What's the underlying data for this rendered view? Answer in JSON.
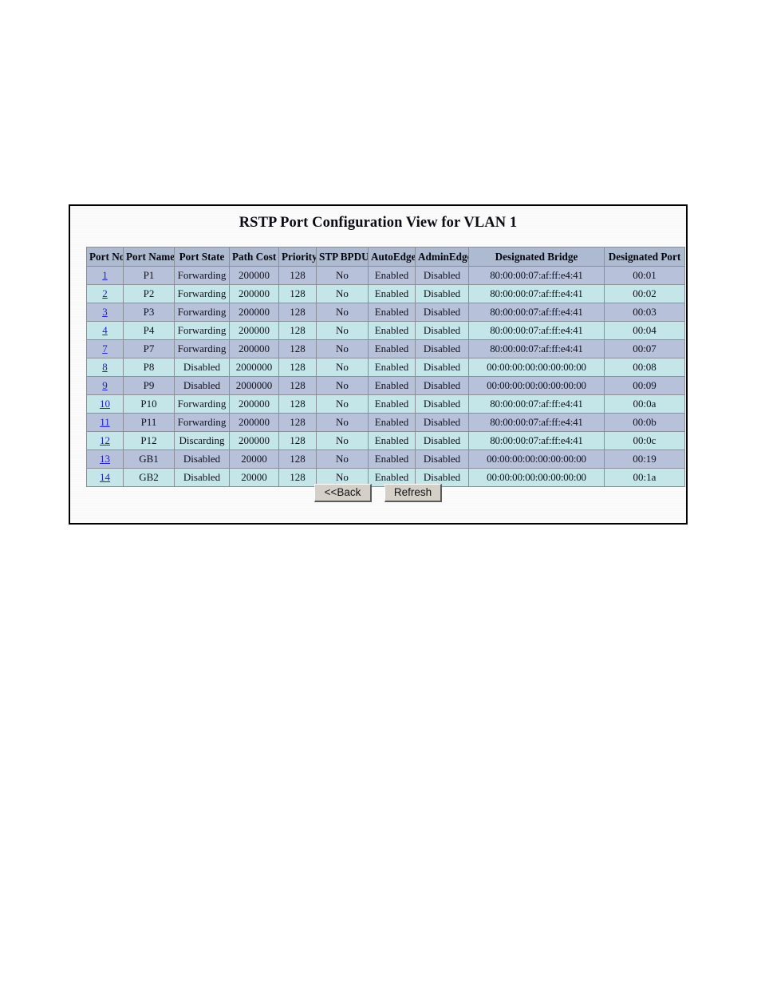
{
  "panel": {
    "title": "RSTP Port Configuration View for VLAN 1"
  },
  "table": {
    "headers": [
      "Port No",
      "Port Name",
      "Port State",
      "Path Cost",
      "Priority",
      "STP BPDU",
      "AutoEdge",
      "AdminEdge",
      "Designated Bridge",
      "Designated Port"
    ],
    "rows": [
      {
        "port_no": "1",
        "port_name": "P1",
        "port_state": "Forwarding",
        "path_cost": "200000",
        "priority": "128",
        "stp_bpdu": "No",
        "auto_edge": "Enabled",
        "admin_edge": "Disabled",
        "designated_bridge": "80:00:00:07:af:ff:e4:41",
        "designated_port": "00:01"
      },
      {
        "port_no": "2",
        "port_name": "P2",
        "port_state": "Forwarding",
        "path_cost": "200000",
        "priority": "128",
        "stp_bpdu": "No",
        "auto_edge": "Enabled",
        "admin_edge": "Disabled",
        "designated_bridge": "80:00:00:07:af:ff:e4:41",
        "designated_port": "00:02"
      },
      {
        "port_no": "3",
        "port_name": "P3",
        "port_state": "Forwarding",
        "path_cost": "200000",
        "priority": "128",
        "stp_bpdu": "No",
        "auto_edge": "Enabled",
        "admin_edge": "Disabled",
        "designated_bridge": "80:00:00:07:af:ff:e4:41",
        "designated_port": "00:03"
      },
      {
        "port_no": "4",
        "port_name": "P4",
        "port_state": "Forwarding",
        "path_cost": "200000",
        "priority": "128",
        "stp_bpdu": "No",
        "auto_edge": "Enabled",
        "admin_edge": "Disabled",
        "designated_bridge": "80:00:00:07:af:ff:e4:41",
        "designated_port": "00:04"
      },
      {
        "port_no": "7",
        "port_name": "P7",
        "port_state": "Forwarding",
        "path_cost": "200000",
        "priority": "128",
        "stp_bpdu": "No",
        "auto_edge": "Enabled",
        "admin_edge": "Disabled",
        "designated_bridge": "80:00:00:07:af:ff:e4:41",
        "designated_port": "00:07"
      },
      {
        "port_no": "8",
        "port_name": "P8",
        "port_state": "Disabled",
        "path_cost": "2000000",
        "priority": "128",
        "stp_bpdu": "No",
        "auto_edge": "Enabled",
        "admin_edge": "Disabled",
        "designated_bridge": "00:00:00:00:00:00:00:00",
        "designated_port": "00:08"
      },
      {
        "port_no": "9",
        "port_name": "P9",
        "port_state": "Disabled",
        "path_cost": "2000000",
        "priority": "128",
        "stp_bpdu": "No",
        "auto_edge": "Enabled",
        "admin_edge": "Disabled",
        "designated_bridge": "00:00:00:00:00:00:00:00",
        "designated_port": "00:09"
      },
      {
        "port_no": "10",
        "port_name": "P10",
        "port_state": "Forwarding",
        "path_cost": "200000",
        "priority": "128",
        "stp_bpdu": "No",
        "auto_edge": "Enabled",
        "admin_edge": "Disabled",
        "designated_bridge": "80:00:00:07:af:ff:e4:41",
        "designated_port": "00:0a"
      },
      {
        "port_no": "11",
        "port_name": "P11",
        "port_state": "Forwarding",
        "path_cost": "200000",
        "priority": "128",
        "stp_bpdu": "No",
        "auto_edge": "Enabled",
        "admin_edge": "Disabled",
        "designated_bridge": "80:00:00:07:af:ff:e4:41",
        "designated_port": "00:0b"
      },
      {
        "port_no": "12",
        "port_name": "P12",
        "port_state": "Discarding",
        "path_cost": "200000",
        "priority": "128",
        "stp_bpdu": "No",
        "auto_edge": "Enabled",
        "admin_edge": "Disabled",
        "designated_bridge": "80:00:00:07:af:ff:e4:41",
        "designated_port": "00:0c"
      },
      {
        "port_no": "13",
        "port_name": "GB1",
        "port_state": "Disabled",
        "path_cost": "20000",
        "priority": "128",
        "stp_bpdu": "No",
        "auto_edge": "Enabled",
        "admin_edge": "Disabled",
        "designated_bridge": "00:00:00:00:00:00:00:00",
        "designated_port": "00:19"
      },
      {
        "port_no": "14",
        "port_name": "GB2",
        "port_state": "Disabled",
        "path_cost": "20000",
        "priority": "128",
        "stp_bpdu": "No",
        "auto_edge": "Enabled",
        "admin_edge": "Disabled",
        "designated_bridge": "00:00:00:00:00:00:00:00",
        "designated_port": "00:1a"
      }
    ]
  },
  "buttons": {
    "back_label": "<<Back",
    "refresh_label": "Refresh"
  },
  "colors": {
    "header_bg": "#adbacf",
    "row_odd_bg": "#b7c1d9",
    "row_even_bg": "#c5e6e8",
    "grid_line": "#8a8f97",
    "link": "#2222cc",
    "panel_border": "#000000",
    "button_face": "#d4d0c8"
  }
}
